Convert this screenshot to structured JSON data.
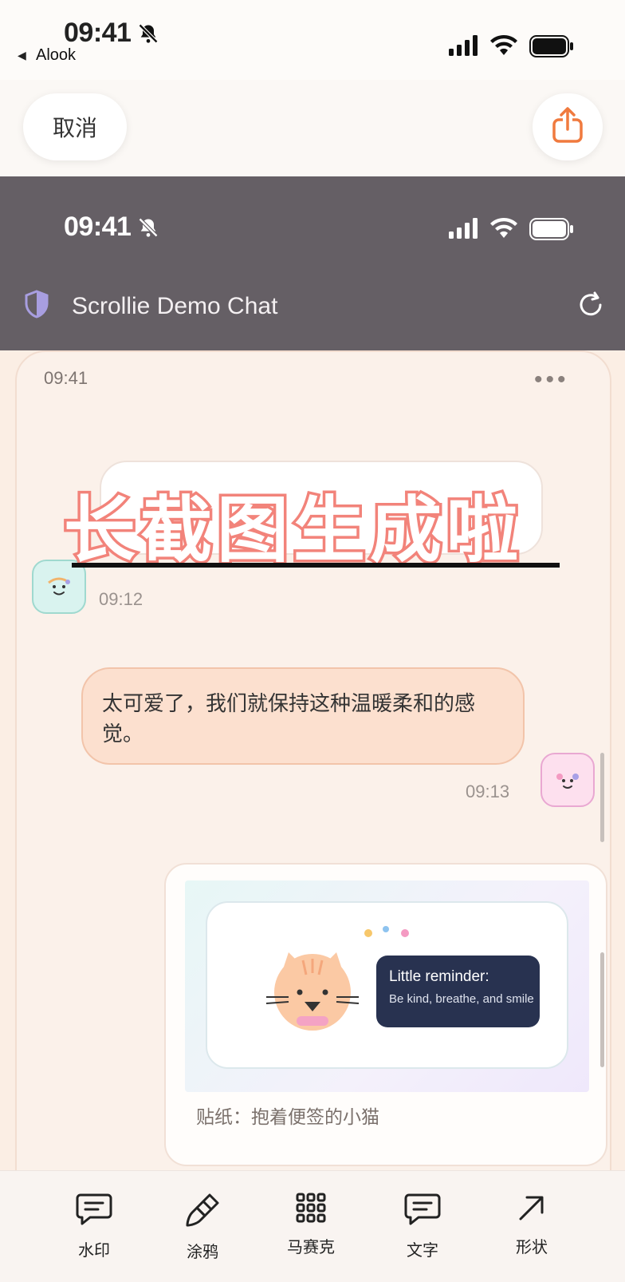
{
  "outer_status": {
    "time": "09:41",
    "back_app": "Alook"
  },
  "topbar": {
    "cancel_label": "取消"
  },
  "inner_status": {
    "time": "09:41"
  },
  "chat": {
    "title": "Scrollie Demo Chat",
    "card_time": "09:41",
    "msg1_time": "09:12",
    "msg2_text": "太可爱了，我们就保持这种温暖柔和的感觉。",
    "msg2_time": "09:13",
    "sticker_reminder_title": "Little reminder:",
    "sticker_reminder_text": "Be kind, breathe, and smile",
    "sticker_caption": "贴纸：抱着便签的小猫"
  },
  "overlay": {
    "text": "长截图生成啦"
  },
  "toolbar": {
    "items": [
      {
        "label": "水印",
        "icon": "watermark-icon"
      },
      {
        "label": "涂鸦",
        "icon": "brush-icon"
      },
      {
        "label": "马赛克",
        "icon": "mosaic-grid-icon"
      },
      {
        "label": "文字",
        "icon": "text-bubble-icon"
      },
      {
        "label": "形状",
        "icon": "arrow-shape-icon"
      }
    ]
  },
  "colors": {
    "accent": "#f07a3e",
    "overlay_stroke": "#f2837a",
    "inner_status_bg": "#655f65"
  }
}
